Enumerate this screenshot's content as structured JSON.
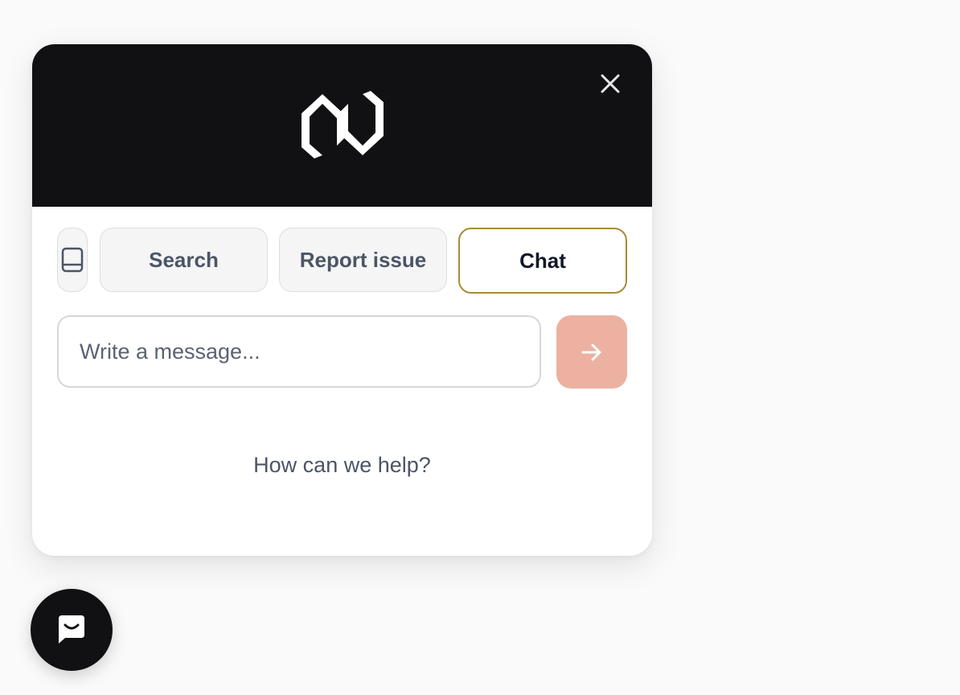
{
  "header": {
    "logo_icon": "brand-logo-icon",
    "close_icon": "close-icon"
  },
  "tabs": [
    {
      "id": "docs",
      "label": "",
      "icon": "book-icon"
    },
    {
      "id": "search",
      "label": "Search"
    },
    {
      "id": "report",
      "label": "Report issue"
    },
    {
      "id": "chat",
      "label": "Chat",
      "active": true
    }
  ],
  "composer": {
    "placeholder": "Write a message...",
    "value": "",
    "send_icon": "arrow-right-icon"
  },
  "empty_state": {
    "text": "How can we help?"
  },
  "launcher": {
    "icon": "chat-bubble-icon"
  },
  "colors": {
    "header_bg": "#111113",
    "active_tab_border": "#a88b35",
    "send_button": "#ecb1a1",
    "page_bg": "#fafafa"
  }
}
